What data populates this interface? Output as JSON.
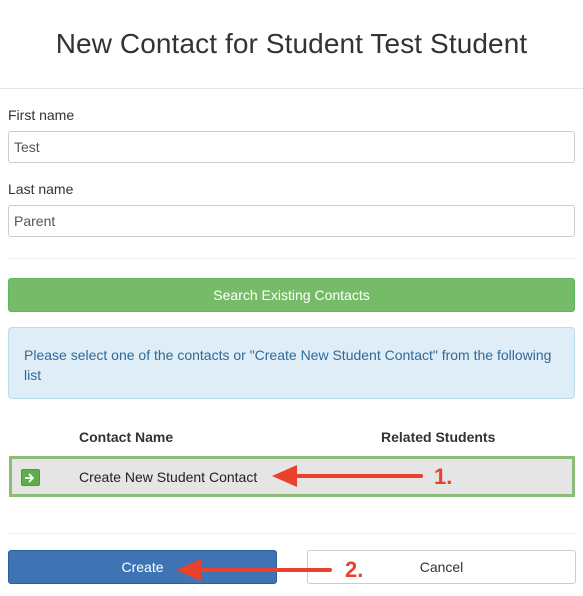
{
  "header": {
    "title": "New Contact for Student Test Student"
  },
  "form": {
    "first_name_label": "First name",
    "first_name_value": "Test",
    "last_name_label": "Last name",
    "last_name_value": "Parent"
  },
  "search_button_label": "Search Existing Contacts",
  "info_message": "Please select one of the contacts or \"Create New Student Contact\" from the following list",
  "table": {
    "columns": [
      "Contact Name",
      "Related Students"
    ],
    "rows": [
      {
        "icon": "arrow-right-icon",
        "contact_name": "Create New Student Contact",
        "related_students": ""
      }
    ]
  },
  "footer": {
    "create_label": "Create",
    "cancel_label": "Cancel"
  },
  "annotations": {
    "step1": "1.",
    "step2": "2.",
    "arrow_color": "#e8412c"
  },
  "colors": {
    "primary": "#3f74b4",
    "success": "#76bb67",
    "info_bg": "#dfedf7",
    "info_text": "#2f6b97"
  }
}
